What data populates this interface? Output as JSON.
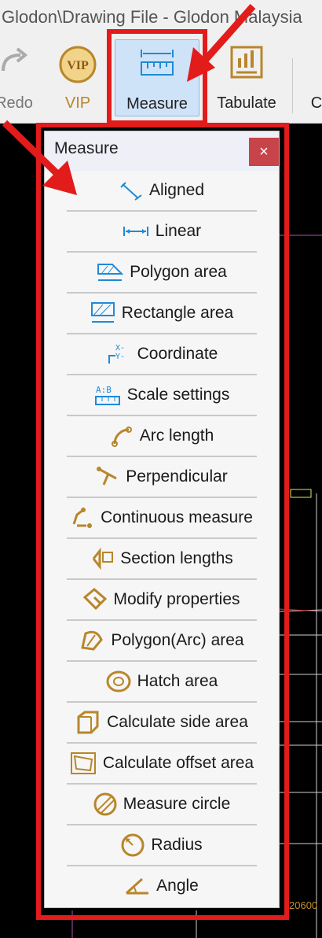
{
  "window": {
    "title": "Glodon\\Drawing File - Glodon Malaysia"
  },
  "ribbon": {
    "redo_label": "Redo",
    "vip_label": "VIP",
    "vip_badge": "VIP",
    "measure_label": "Measure",
    "tabulate_label": "Tabulate",
    "next_label": "C"
  },
  "panel": {
    "title": "Measure",
    "close_glyph": "×",
    "items": [
      {
        "label": "Aligned",
        "icon": "aligned-icon"
      },
      {
        "label": "Linear",
        "icon": "linear-icon"
      },
      {
        "label": "Polygon area",
        "icon": "polygon-area-icon"
      },
      {
        "label": "Rectangle area",
        "icon": "rectangle-area-icon"
      },
      {
        "label": "Coordinate",
        "icon": "coordinate-icon"
      },
      {
        "label": "Scale settings",
        "icon": "scale-settings-icon"
      },
      {
        "label": "Arc length",
        "icon": "arc-length-icon"
      },
      {
        "label": "Perpendicular",
        "icon": "perpendicular-icon"
      },
      {
        "label": "Continuous measure",
        "icon": "continuous-measure-icon"
      },
      {
        "label": "Section lengths",
        "icon": "section-lengths-icon"
      },
      {
        "label": "Modify properties",
        "icon": "modify-properties-icon"
      },
      {
        "label": "Polygon(Arc) area",
        "icon": "polygon-arc-area-icon"
      },
      {
        "label": "Hatch area",
        "icon": "hatch-area-icon"
      },
      {
        "label": "Calculate side area",
        "icon": "side-area-icon"
      },
      {
        "label": "Calculate offset area",
        "icon": "offset-area-icon"
      },
      {
        "label": "Measure circle",
        "icon": "measure-circle-icon"
      },
      {
        "label": "Radius",
        "icon": "radius-icon"
      },
      {
        "label": "Angle",
        "icon": "angle-icon"
      }
    ]
  },
  "canvas": {
    "dimension_text": "20600"
  },
  "colors": {
    "annotation_red": "#e21b1b",
    "blue_icon": "#1f8ad8",
    "gold_icon": "#b8862b",
    "selected_bg": "#cfe3f8"
  }
}
